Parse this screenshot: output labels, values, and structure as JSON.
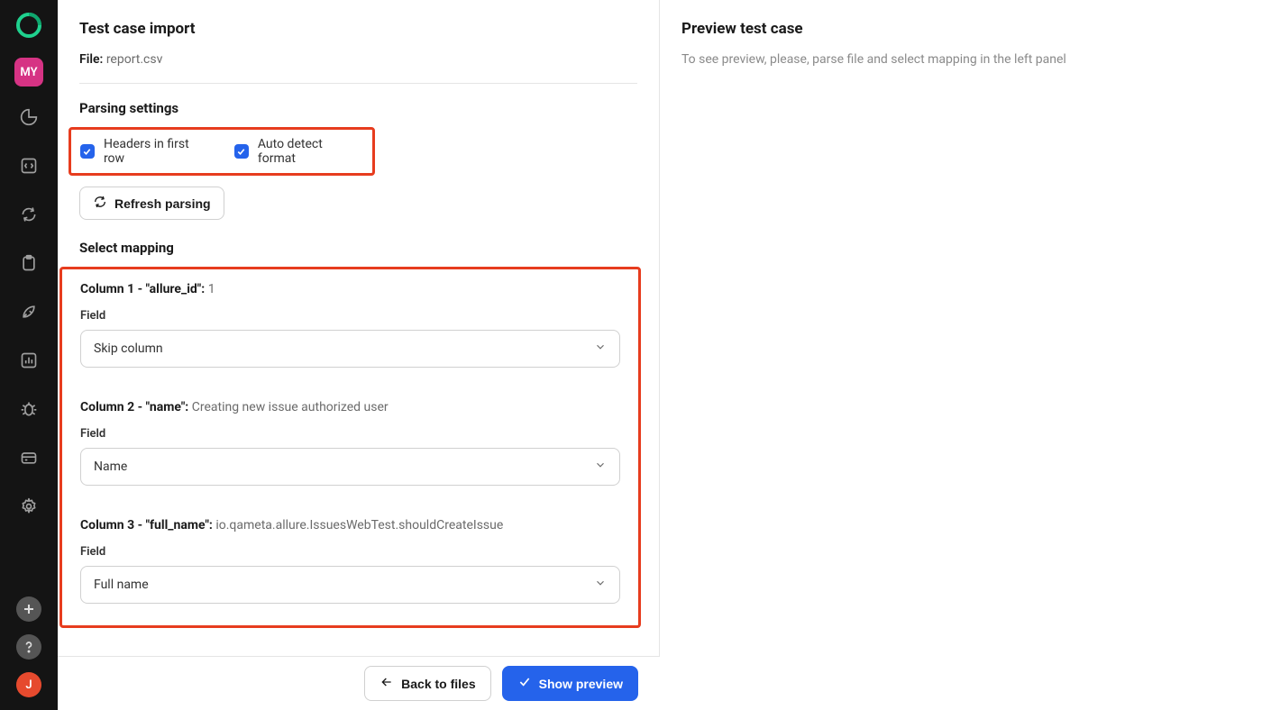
{
  "sidebar": {
    "project_badge": "MY",
    "user_initial": "J"
  },
  "left": {
    "title": "Test case import",
    "file_label": "File:",
    "file_name": "report.csv",
    "parsing_title": "Parsing settings",
    "checkbox_headers": "Headers in first row",
    "checkbox_autodetect": "Auto detect format",
    "refresh_label": "Refresh parsing",
    "mapping_title": "Select mapping",
    "field_label": "Field",
    "columns": [
      {
        "header_strong": "Column 1 - \"allure_id\":",
        "sample": "1",
        "value": "Skip column"
      },
      {
        "header_strong": "Column 2 - \"name\":",
        "sample": "Creating new issue authorized user",
        "value": "Name"
      },
      {
        "header_strong": "Column 3 - \"full_name\":",
        "sample": "io.qameta.allure.IssuesWebTest.shouldCreateIssue",
        "value": "Full name"
      }
    ]
  },
  "right": {
    "title": "Preview test case",
    "message": "To see preview, please, parse file and select mapping in the left panel"
  },
  "footer": {
    "back_label": "Back to files",
    "preview_label": "Show preview"
  }
}
